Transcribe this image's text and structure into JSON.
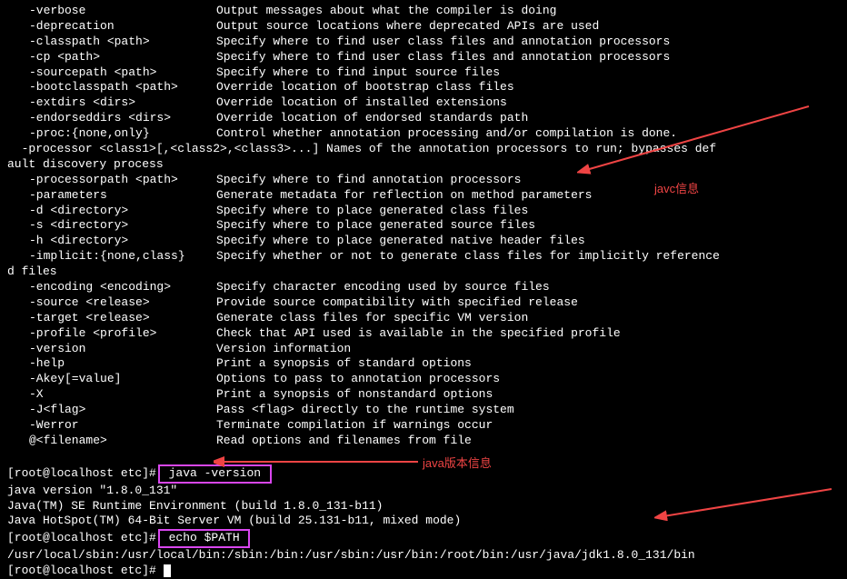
{
  "options": [
    {
      "key": "-verbose",
      "desc": "Output messages about what the compiler is doing"
    },
    {
      "key": "-deprecation",
      "desc": "Output source locations where deprecated APIs are used"
    },
    {
      "key": "-classpath <path>",
      "desc": "Specify where to find user class files and annotation processors"
    },
    {
      "key": "-cp <path>",
      "desc": "Specify where to find user class files and annotation processors"
    },
    {
      "key": "-sourcepath <path>",
      "desc": "Specify where to find input source files"
    },
    {
      "key": "-bootclasspath <path>",
      "desc": "Override location of bootstrap class files"
    },
    {
      "key": "-extdirs <dirs>",
      "desc": "Override location of installed extensions"
    },
    {
      "key": "-endorseddirs <dirs>",
      "desc": "Override location of endorsed standards path"
    },
    {
      "key": "-proc:{none,only}",
      "desc": "Control whether annotation processing and/or compilation is done."
    }
  ],
  "processor_line1": "  -processor <class1>[,<class2>,<class3>...] Names of the annotation processors to run; bypasses def",
  "processor_line2": "ault discovery process",
  "options2": [
    {
      "key": "-processorpath <path>",
      "desc": "Specify where to find annotation processors"
    },
    {
      "key": "-parameters",
      "desc": "Generate metadata for reflection on method parameters"
    },
    {
      "key": "-d <directory>",
      "desc": "Specify where to place generated class files"
    },
    {
      "key": "-s <directory>",
      "desc": "Specify where to place generated source files"
    },
    {
      "key": "-h <directory>",
      "desc": "Specify where to place generated native header files"
    }
  ],
  "implicit_line1_key": "-implicit:{none,class}",
  "implicit_line1_desc": "Specify whether or not to generate class files for implicitly reference",
  "implicit_line2": "d files",
  "options3": [
    {
      "key": "-encoding <encoding>",
      "desc": "Specify character encoding used by source files"
    },
    {
      "key": "-source <release>",
      "desc": "Provide source compatibility with specified release"
    },
    {
      "key": "-target <release>",
      "desc": "Generate class files for specific VM version"
    },
    {
      "key": "-profile <profile>",
      "desc": "Check that API used is available in the specified profile"
    },
    {
      "key": "-version",
      "desc": "Version information"
    },
    {
      "key": "-help",
      "desc": "Print a synopsis of standard options"
    },
    {
      "key": "-Akey[=value]",
      "desc": "Options to pass to annotation processors"
    },
    {
      "key": "-X",
      "desc": "Print a synopsis of nonstandard options"
    },
    {
      "key": "-J<flag>",
      "desc": "Pass <flag> directly to the runtime system"
    },
    {
      "key": "-Werror",
      "desc": "Terminate compilation if warnings occur"
    },
    {
      "key": "@<filename>",
      "desc": "Read options and filenames from file"
    }
  ],
  "prompt": "[root@localhost etc]#",
  "cmd_java_version": " java -version ",
  "java_version_line1": "java version \"1.8.0_131\"",
  "java_version_line2": "Java(TM) SE Runtime Environment (build 1.8.0_131-b11)",
  "java_version_line3": "Java HotSpot(TM) 64-Bit Server VM (build 25.131-b11, mixed mode)",
  "cmd_echo_path": " echo $PATH ",
  "path_output": "/usr/local/sbin:/usr/local/bin:/sbin:/bin:/usr/sbin:/usr/bin:/root/bin:/usr/java/jdk1.8.0_131/bin",
  "annotation_javc": "javc信息",
  "annotation_java_version": "java版本信息",
  "colors": {
    "annotation": "#ef4444",
    "highlight_border": "#d946ef",
    "bg": "#000000",
    "fg": "#ffffff"
  }
}
